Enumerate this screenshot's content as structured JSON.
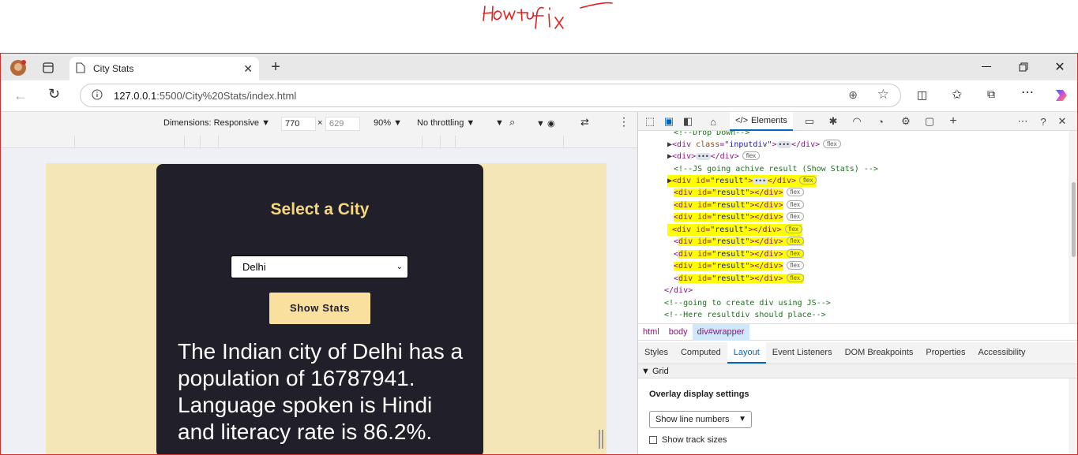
{
  "annotation": {
    "text": "HOW to fix"
  },
  "browser": {
    "tab_title": "City Stats",
    "url_host": "127.0.0.1",
    "url_rest": ":5500/City%20Stats/index.html"
  },
  "device_toolbar": {
    "dimensions_label": "Dimensions: Responsive",
    "width": "770",
    "times": "×",
    "height": "629",
    "zoom": "90%",
    "throttling": "No throttling"
  },
  "app": {
    "title": "Select a City",
    "selected_city": "Delhi",
    "button_label": "Show Stats",
    "result_text": "The Indian city of Delhi has a population of 16787941. Language spoken is Hindi and literacy rate is 86.2%."
  },
  "devtools": {
    "elements_tab": "Elements",
    "flex_badge": "flex",
    "breadcrumb": [
      "html",
      "body",
      "div#wrapper"
    ],
    "subtabs": [
      "Styles",
      "Computed",
      "Layout",
      "Event Listeners",
      "DOM Breakpoints",
      "Properties",
      "Accessibility"
    ],
    "active_subtab": "Layout",
    "grid_section": "Grid",
    "overlay_title": "Overlay display settings",
    "line_numbers_option": "Show line numbers",
    "track_sizes_label": "Show track sizes",
    "dom_lines": [
      {
        "type": "comment",
        "text": "<!--Drop Down-->"
      },
      {
        "type": "div",
        "attr": "class",
        "value": "inputdiv",
        "collapsed": true
      },
      {
        "type": "div",
        "collapsed": true
      },
      {
        "type": "comment",
        "text": "<!--JS going achive result (Show Stats) -->"
      },
      {
        "type": "div",
        "attr": "id",
        "value": "result",
        "collapsed": true
      },
      {
        "type": "div",
        "attr": "id",
        "value": "result"
      },
      {
        "type": "div",
        "attr": "id",
        "value": "result"
      },
      {
        "type": "div",
        "attr": "id",
        "value": "result"
      },
      {
        "type": "div",
        "attr": "id",
        "value": "result"
      },
      {
        "type": "div",
        "attr": "id",
        "value": "result"
      },
      {
        "type": "div",
        "attr": "id",
        "value": "result"
      },
      {
        "type": "div",
        "attr": "id",
        "value": "result"
      },
      {
        "type": "div",
        "attr": "id",
        "value": "result"
      },
      {
        "type": "close",
        "text": "</div>"
      },
      {
        "type": "comment",
        "text": "<!--going to create div using JS-->"
      },
      {
        "type": "comment",
        "text": "<!--Here resultdiv should place-->"
      }
    ]
  }
}
